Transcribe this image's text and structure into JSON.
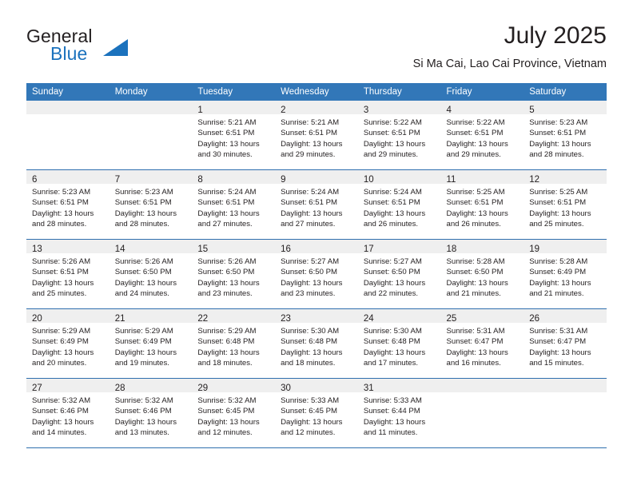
{
  "logo": {
    "word_one": "General",
    "word_two": "Blue",
    "triangle_color": "#1b72bd",
    "text_color": "#231f20"
  },
  "header": {
    "title": "July 2025",
    "subtitle": "Si Ma Cai, Lao Cai Province, Vietnam"
  },
  "theme": {
    "header_blue": "#3277b8",
    "rule_blue": "#2f6fae",
    "daynum_band": "#efefef",
    "text": "#231f20"
  },
  "weekday_headers": [
    "Sunday",
    "Monday",
    "Tuesday",
    "Wednesday",
    "Thursday",
    "Friday",
    "Saturday"
  ],
  "weeks": [
    [
      {
        "day": "",
        "lines": []
      },
      {
        "day": "",
        "lines": []
      },
      {
        "day": "1",
        "lines": [
          "Sunrise: 5:21 AM",
          "Sunset: 6:51 PM",
          "Daylight: 13 hours",
          "and 30 minutes."
        ]
      },
      {
        "day": "2",
        "lines": [
          "Sunrise: 5:21 AM",
          "Sunset: 6:51 PM",
          "Daylight: 13 hours",
          "and 29 minutes."
        ]
      },
      {
        "day": "3",
        "lines": [
          "Sunrise: 5:22 AM",
          "Sunset: 6:51 PM",
          "Daylight: 13 hours",
          "and 29 minutes."
        ]
      },
      {
        "day": "4",
        "lines": [
          "Sunrise: 5:22 AM",
          "Sunset: 6:51 PM",
          "Daylight: 13 hours",
          "and 29 minutes."
        ]
      },
      {
        "day": "5",
        "lines": [
          "Sunrise: 5:23 AM",
          "Sunset: 6:51 PM",
          "Daylight: 13 hours",
          "and 28 minutes."
        ]
      }
    ],
    [
      {
        "day": "6",
        "lines": [
          "Sunrise: 5:23 AM",
          "Sunset: 6:51 PM",
          "Daylight: 13 hours",
          "and 28 minutes."
        ]
      },
      {
        "day": "7",
        "lines": [
          "Sunrise: 5:23 AM",
          "Sunset: 6:51 PM",
          "Daylight: 13 hours",
          "and 28 minutes."
        ]
      },
      {
        "day": "8",
        "lines": [
          "Sunrise: 5:24 AM",
          "Sunset: 6:51 PM",
          "Daylight: 13 hours",
          "and 27 minutes."
        ]
      },
      {
        "day": "9",
        "lines": [
          "Sunrise: 5:24 AM",
          "Sunset: 6:51 PM",
          "Daylight: 13 hours",
          "and 27 minutes."
        ]
      },
      {
        "day": "10",
        "lines": [
          "Sunrise: 5:24 AM",
          "Sunset: 6:51 PM",
          "Daylight: 13 hours",
          "and 26 minutes."
        ]
      },
      {
        "day": "11",
        "lines": [
          "Sunrise: 5:25 AM",
          "Sunset: 6:51 PM",
          "Daylight: 13 hours",
          "and 26 minutes."
        ]
      },
      {
        "day": "12",
        "lines": [
          "Sunrise: 5:25 AM",
          "Sunset: 6:51 PM",
          "Daylight: 13 hours",
          "and 25 minutes."
        ]
      }
    ],
    [
      {
        "day": "13",
        "lines": [
          "Sunrise: 5:26 AM",
          "Sunset: 6:51 PM",
          "Daylight: 13 hours",
          "and 25 minutes."
        ]
      },
      {
        "day": "14",
        "lines": [
          "Sunrise: 5:26 AM",
          "Sunset: 6:50 PM",
          "Daylight: 13 hours",
          "and 24 minutes."
        ]
      },
      {
        "day": "15",
        "lines": [
          "Sunrise: 5:26 AM",
          "Sunset: 6:50 PM",
          "Daylight: 13 hours",
          "and 23 minutes."
        ]
      },
      {
        "day": "16",
        "lines": [
          "Sunrise: 5:27 AM",
          "Sunset: 6:50 PM",
          "Daylight: 13 hours",
          "and 23 minutes."
        ]
      },
      {
        "day": "17",
        "lines": [
          "Sunrise: 5:27 AM",
          "Sunset: 6:50 PM",
          "Daylight: 13 hours",
          "and 22 minutes."
        ]
      },
      {
        "day": "18",
        "lines": [
          "Sunrise: 5:28 AM",
          "Sunset: 6:50 PM",
          "Daylight: 13 hours",
          "and 21 minutes."
        ]
      },
      {
        "day": "19",
        "lines": [
          "Sunrise: 5:28 AM",
          "Sunset: 6:49 PM",
          "Daylight: 13 hours",
          "and 21 minutes."
        ]
      }
    ],
    [
      {
        "day": "20",
        "lines": [
          "Sunrise: 5:29 AM",
          "Sunset: 6:49 PM",
          "Daylight: 13 hours",
          "and 20 minutes."
        ]
      },
      {
        "day": "21",
        "lines": [
          "Sunrise: 5:29 AM",
          "Sunset: 6:49 PM",
          "Daylight: 13 hours",
          "and 19 minutes."
        ]
      },
      {
        "day": "22",
        "lines": [
          "Sunrise: 5:29 AM",
          "Sunset: 6:48 PM",
          "Daylight: 13 hours",
          "and 18 minutes."
        ]
      },
      {
        "day": "23",
        "lines": [
          "Sunrise: 5:30 AM",
          "Sunset: 6:48 PM",
          "Daylight: 13 hours",
          "and 18 minutes."
        ]
      },
      {
        "day": "24",
        "lines": [
          "Sunrise: 5:30 AM",
          "Sunset: 6:48 PM",
          "Daylight: 13 hours",
          "and 17 minutes."
        ]
      },
      {
        "day": "25",
        "lines": [
          "Sunrise: 5:31 AM",
          "Sunset: 6:47 PM",
          "Daylight: 13 hours",
          "and 16 minutes."
        ]
      },
      {
        "day": "26",
        "lines": [
          "Sunrise: 5:31 AM",
          "Sunset: 6:47 PM",
          "Daylight: 13 hours",
          "and 15 minutes."
        ]
      }
    ],
    [
      {
        "day": "27",
        "lines": [
          "Sunrise: 5:32 AM",
          "Sunset: 6:46 PM",
          "Daylight: 13 hours",
          "and 14 minutes."
        ]
      },
      {
        "day": "28",
        "lines": [
          "Sunrise: 5:32 AM",
          "Sunset: 6:46 PM",
          "Daylight: 13 hours",
          "and 13 minutes."
        ]
      },
      {
        "day": "29",
        "lines": [
          "Sunrise: 5:32 AM",
          "Sunset: 6:45 PM",
          "Daylight: 13 hours",
          "and 12 minutes."
        ]
      },
      {
        "day": "30",
        "lines": [
          "Sunrise: 5:33 AM",
          "Sunset: 6:45 PM",
          "Daylight: 13 hours",
          "and 12 minutes."
        ]
      },
      {
        "day": "31",
        "lines": [
          "Sunrise: 5:33 AM",
          "Sunset: 6:44 PM",
          "Daylight: 13 hours",
          "and 11 minutes."
        ]
      },
      {
        "day": "",
        "lines": []
      },
      {
        "day": "",
        "lines": []
      }
    ]
  ]
}
